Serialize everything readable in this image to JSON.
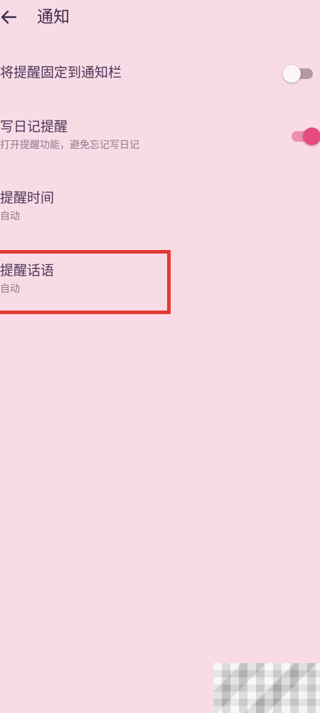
{
  "header": {
    "title": "通知",
    "back_icon": "arrow-left-icon"
  },
  "settings": [
    {
      "title": "将提醒固定到通知栏",
      "subtitle": "",
      "control": "toggle",
      "state": "off"
    },
    {
      "title": "写日记提醒",
      "subtitle": "打开提醒功能，避免忘记写日记",
      "control": "toggle",
      "state": "on"
    },
    {
      "title": "提醒时间",
      "subtitle": "自动"
    },
    {
      "title": "提醒话语",
      "subtitle": "自动"
    }
  ],
  "colors": {
    "background": "#f9dbe5",
    "toggle_on_thumb": "#e54b7e",
    "toggle_on_track": "#ef8fae",
    "toggle_off_track": "#b59aa3",
    "highlight_box": "#e43a34"
  }
}
